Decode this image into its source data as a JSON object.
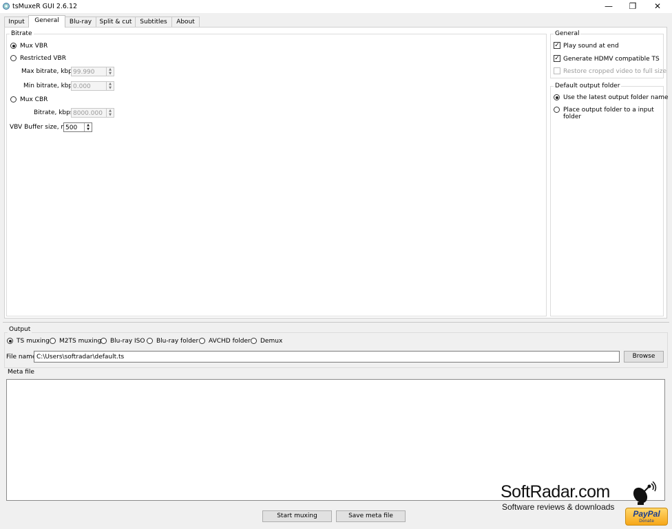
{
  "window": {
    "title": "tsMuxeR GUI 2.6.12",
    "minimize_glyph": "—",
    "restore_glyph": "❐",
    "close_glyph": "✕"
  },
  "tabs": [
    "Input",
    "General",
    "Blu-ray",
    "Split & cut",
    "Subtitles",
    "About"
  ],
  "active_tab": "General",
  "bitrate": {
    "title": "Bitrate",
    "mux_vbr": "Mux VBR",
    "restricted_vbr": "Restricted VBR",
    "max_bitrate_label": "Max bitrate, kbps",
    "max_bitrate_value": "99.990",
    "min_bitrate_label": "Min bitrate, kbps",
    "min_bitrate_value": "0.000",
    "mux_cbr": "Mux CBR",
    "cbr_bitrate_label": "Bitrate, kbps",
    "cbr_bitrate_value": "8000.000",
    "vbv_label": "VBV Buffer size, ms",
    "vbv_value": "500"
  },
  "general": {
    "title": "General",
    "play_sound": "Play sound at end",
    "hdmv_ts": "Generate HDMV compatible TS",
    "restore_cropped": "Restore cropped video to full size"
  },
  "output_folder": {
    "title": "Default output folder",
    "latest": "Use the latest output folder name",
    "input": "Place output folder to a input folder"
  },
  "output": {
    "title": "Output",
    "modes": [
      "TS muxing",
      "M2TS muxing",
      "Blu-ray ISO",
      "Blu-ray folder",
      "AVCHD folder",
      "Demux"
    ],
    "file_name_label": "File name",
    "file_name_value": "C:\\Users\\softradar\\default.ts",
    "browse": "Browse"
  },
  "meta": {
    "title": "Meta file",
    "content": ""
  },
  "actions": {
    "start": "Start muxing",
    "save_meta": "Save meta file"
  },
  "watermark": {
    "title": "SoftRadar.com",
    "subtitle": "Software reviews & downloads"
  },
  "paypal": {
    "brand": "PayPal",
    "label": "Donate"
  },
  "colors": {
    "window_bg": "#f0f0f0",
    "panel_bg": "#ffffff",
    "paypal_gold": "#f7a719",
    "paypal_blue": "#1b3d8f"
  }
}
